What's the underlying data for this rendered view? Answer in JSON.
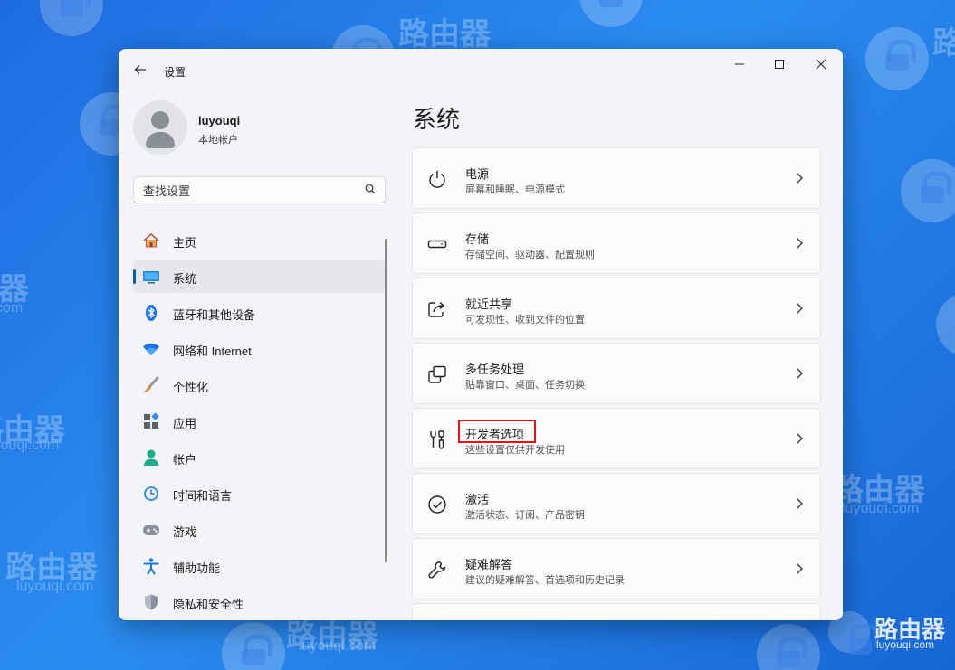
{
  "watermark": {
    "brand_text": "路由器",
    "domain_text": "luyouqi.com"
  },
  "window": {
    "title": "设置",
    "controls": {
      "minimize": "—",
      "maximize": "☐",
      "close": "✕"
    }
  },
  "profile": {
    "name": "luyouqi",
    "account_type": "本地帐户"
  },
  "search": {
    "placeholder": "查找设置"
  },
  "sidebar": {
    "items": [
      {
        "label": "主页",
        "icon": "home-icon"
      },
      {
        "label": "系统",
        "icon": "system-icon",
        "active": true
      },
      {
        "label": "蓝牙和其他设备",
        "icon": "bluetooth-icon"
      },
      {
        "label": "网络和 Internet",
        "icon": "wifi-icon"
      },
      {
        "label": "个性化",
        "icon": "brush-icon"
      },
      {
        "label": "应用",
        "icon": "apps-icon"
      },
      {
        "label": "帐户",
        "icon": "account-icon"
      },
      {
        "label": "时间和语言",
        "icon": "time-language-icon"
      },
      {
        "label": "游戏",
        "icon": "gamepad-icon"
      },
      {
        "label": "辅助功能",
        "icon": "accessibility-icon"
      },
      {
        "label": "隐私和安全性",
        "icon": "shield-icon"
      }
    ]
  },
  "main": {
    "title": "系统",
    "cards": [
      {
        "title": "电源",
        "subtitle": "屏幕和睡眠、电源模式",
        "icon": "power-icon"
      },
      {
        "title": "存储",
        "subtitle": "存储空间、驱动器、配置规则",
        "icon": "storage-icon"
      },
      {
        "title": "就近共享",
        "subtitle": "可发现性、收到文件的位置",
        "icon": "share-icon"
      },
      {
        "title": "多任务处理",
        "subtitle": "贴靠窗口、桌面、任务切换",
        "icon": "multitask-icon"
      },
      {
        "title": "开发者选项",
        "subtitle": "这些设置仅供开发使用",
        "icon": "developer-icon",
        "highlighted": true
      },
      {
        "title": "激活",
        "subtitle": "激活状态、订阅、产品密钥",
        "icon": "activation-icon"
      },
      {
        "title": "疑难解答",
        "subtitle": "建议的疑难解答、首选项和历史记录",
        "icon": "wrench-icon"
      }
    ]
  },
  "colors": {
    "accent": "#005fb8",
    "highlight_box": "#e0131b",
    "desktop": "#1e6ce0"
  }
}
